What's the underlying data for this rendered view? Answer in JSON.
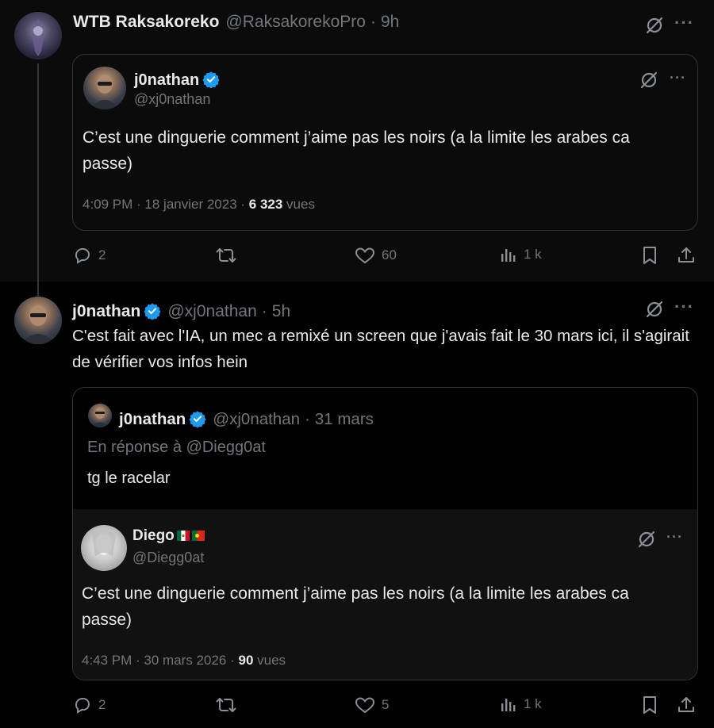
{
  "tweet1": {
    "display_name": "WTB Raksakoreko",
    "handle": "@RaksakorekoPro",
    "time": "9h",
    "quoted": {
      "display_name": "j0nathan",
      "handle": "@xj0nathan",
      "text": "C’est une dinguerie comment j’aime pas les noirs (a la limite les arabes ca passe)",
      "timestamp": "4:09 PM · 18 janvier 2023 · ",
      "views_count": "6 323",
      "views_label": " vues"
    },
    "actions": {
      "replies": "2",
      "likes": "60",
      "views": "1 k"
    }
  },
  "tweet2": {
    "display_name": "j0nathan",
    "handle": "@xj0nathan",
    "time": "5h",
    "text": "C'est fait avec l'IA, un mec a remixé un screen que j'avais fait le 30 mars ici, il s'agirait de vérifier vos infos hein",
    "quoted": {
      "display_name": "j0nathan",
      "handle": "@xj0nathan",
      "date": "31 mars",
      "reply_to": "En réponse à @Diegg0at",
      "text": "tg le racelar",
      "nested": {
        "display_name": "Diego",
        "handle": "@Diegg0at",
        "text": "C’est une dinguerie comment j’aime pas les noirs (a la limite les arabes ca passe)",
        "timestamp": "4:43 PM · 30 mars 2026 · ",
        "views_count": "90",
        "views_label": " vues"
      }
    },
    "actions": {
      "replies": "2",
      "likes": "5",
      "views": "1 k"
    }
  },
  "colors": {
    "verified": "#1d9bf0",
    "muted": "#71767b",
    "text": "#e7e9ea",
    "border": "#2f3336"
  },
  "icons": [
    "reply-icon",
    "retweet-icon",
    "like-icon",
    "views-icon",
    "bookmark-icon",
    "share-icon",
    "grok-icon",
    "more-icon",
    "verified-badge-icon",
    "mexico-flag-icon",
    "portugal-flag-icon"
  ]
}
